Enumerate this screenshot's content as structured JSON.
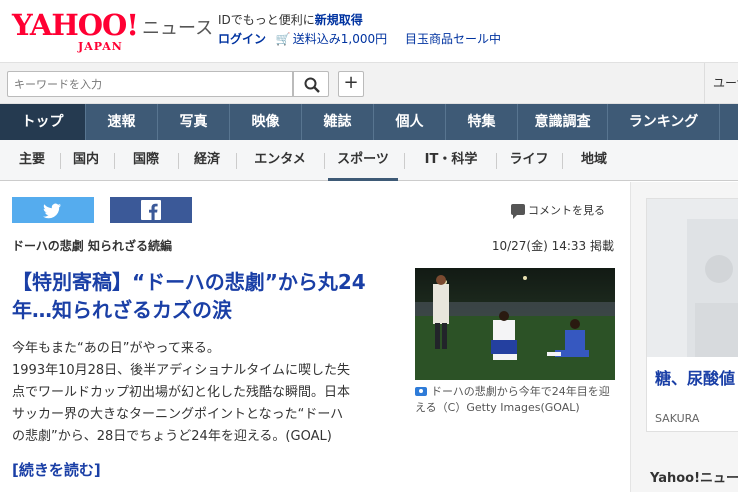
{
  "header": {
    "logo_main": "YAHOO!",
    "logo_sub": "JAPAN",
    "logo_section": "ニュース",
    "promo_line1_prefix": "IDでもっと便利に",
    "promo_line1_link": "新規取得",
    "promo_login": "ログイン",
    "promo_shipping": "送料込み1,000円",
    "promo_sale": "目玉商品セール中"
  },
  "search": {
    "placeholder": "キーワードを入力",
    "add_label": "+",
    "user_link": "ユーザー"
  },
  "main_nav": [
    {
      "label": "トップ",
      "active": true
    },
    {
      "label": "速報"
    },
    {
      "label": "写真"
    },
    {
      "label": "映像"
    },
    {
      "label": "雑誌"
    },
    {
      "label": "個人"
    },
    {
      "label": "特集"
    },
    {
      "label": "意識調査"
    },
    {
      "label": "ランキング"
    }
  ],
  "sub_nav": [
    {
      "label": "主要"
    },
    {
      "label": "国内"
    },
    {
      "label": "国際"
    },
    {
      "label": "経済"
    },
    {
      "label": "エンタメ"
    },
    {
      "label": "スポーツ",
      "active": true
    },
    {
      "label": "IT・科学"
    },
    {
      "label": "ライフ"
    },
    {
      "label": "地域"
    }
  ],
  "article": {
    "comment_link": "コメントを見る",
    "series": "ドーハの悲劇 知られざる続編",
    "date": "10/27(金) 14:33 掲載",
    "headline": "【特別寄稿】“ドーハの悲劇”から丸24年…知られざるカズの涙",
    "body_lines": [
      "今年もまた“あの日”がやって来る。",
      "1993年10月28日、後半アディショナルタイムに喫した失",
      "点でワールドカップ初出場が幻と化した残酷な瞬間。日本",
      "サッカー界の大きなターニングポイントとなった“ドーハ",
      "の悲劇”から、28日でちょうど24年を迎える。(GOAL)"
    ],
    "read_more": "[続きを読む]",
    "photo_caption": "ドーハの悲劇から今年で24年目を迎える（C）Getty Images(GOAL)"
  },
  "sidebar": {
    "ad_title": "糖、尿酸値",
    "ad_sponsor": "SAKURA",
    "section_heading": "Yahoo!ニュース"
  },
  "colors": {
    "brand_red": "#ff0033",
    "nav_blue": "#3e5a76",
    "link_blue": "#1a3fa6",
    "twitter": "#55acee",
    "facebook": "#3b5998"
  }
}
